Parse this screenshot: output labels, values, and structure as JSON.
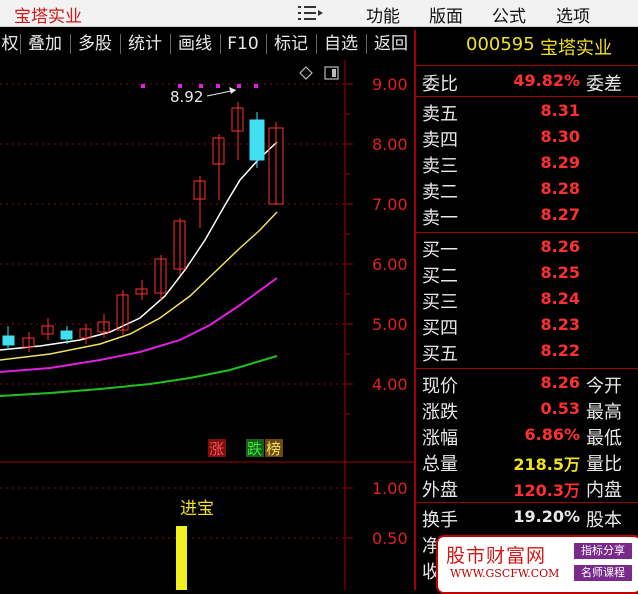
{
  "title_bar": {
    "app_name": "宝塔实业",
    "menus": [
      "功能",
      "版面",
      "公式",
      "选项"
    ]
  },
  "toolbar": {
    "buttons": [
      "权",
      "叠加",
      "多股",
      "统计",
      "画线",
      "F10",
      "标记",
      "自选",
      "返回"
    ]
  },
  "chart": {
    "price_axis": [
      "9.00",
      "8.00",
      "7.00",
      "6.00",
      "5.00",
      "4.00"
    ],
    "volume_axis": [
      "1.00",
      "0.50"
    ],
    "annotation": "8.92",
    "badges": [
      "涨",
      "跌",
      "榜"
    ],
    "indicator_label": "进宝",
    "colors": {
      "up": "#ff3030",
      "down": "#40e0f0",
      "ma5": "#ffffff",
      "ma10": "#f0e060",
      "ma20": "#e020e0",
      "ma60": "#20c020"
    }
  },
  "quote": {
    "code": "000595",
    "name": "宝塔实业",
    "weibi": {
      "label": "委比",
      "value": "49.82%",
      "label2": "委差"
    },
    "sell": [
      {
        "label": "卖五",
        "price": "8.31"
      },
      {
        "label": "卖四",
        "price": "8.30"
      },
      {
        "label": "卖三",
        "price": "8.29"
      },
      {
        "label": "卖二",
        "price": "8.28"
      },
      {
        "label": "卖一",
        "price": "8.27"
      }
    ],
    "buy": [
      {
        "label": "买一",
        "price": "8.26"
      },
      {
        "label": "买二",
        "price": "8.25"
      },
      {
        "label": "买三",
        "price": "8.24"
      },
      {
        "label": "买四",
        "price": "8.23"
      },
      {
        "label": "买五",
        "price": "8.22"
      }
    ],
    "stats": [
      {
        "label": "现价",
        "value": "8.26",
        "label2": "今开"
      },
      {
        "label": "涨跌",
        "value": "0.53",
        "label2": "最高"
      },
      {
        "label": "涨幅",
        "value": "6.86%",
        "label2": "最低"
      },
      {
        "label": "总量",
        "value": "218.5万",
        "label2": "量比"
      },
      {
        "label": "外盘",
        "value": "120.3万",
        "label2": "内盘"
      }
    ],
    "turnover": {
      "label": "换手",
      "value": "19.20%",
      "label2": "股本"
    },
    "partial_labels": [
      "净",
      "收"
    ]
  },
  "watermark": {
    "main": "股市财富网",
    "url": "WWW.GSCFW.COM",
    "tag1": "指标分享",
    "tag2": "名师课程"
  }
}
